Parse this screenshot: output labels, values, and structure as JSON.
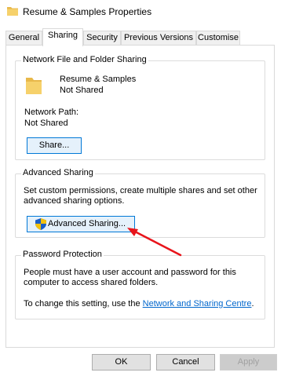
{
  "window": {
    "title": "Resume & Samples Properties"
  },
  "tabs": [
    {
      "label": "General"
    },
    {
      "label": "Sharing"
    },
    {
      "label": "Security"
    },
    {
      "label": "Previous Versions"
    },
    {
      "label": "Customise"
    }
  ],
  "active_tab": "Sharing",
  "network_sharing": {
    "group_title": "Network File and Folder Sharing",
    "folder_name": "Resume & Samples",
    "share_status": "Not Shared",
    "network_path_label": "Network Path:",
    "network_path_value": "Not Shared",
    "share_button": "Share..."
  },
  "advanced_sharing": {
    "group_title": "Advanced Sharing",
    "line1": "Set custom permissions, create multiple shares and set other",
    "line2": "advanced sharing options.",
    "button": "Advanced Sharing..."
  },
  "password_protection": {
    "group_title": "Password Protection",
    "line1": "People must have a user account and password for this",
    "line2": "computer to access shared folders.",
    "change_prefix": "To change this setting, use the ",
    "link_text": "Network and Sharing Centre",
    "change_suffix": "."
  },
  "footer": {
    "ok": "OK",
    "cancel": "Cancel",
    "apply": "Apply"
  },
  "colors": {
    "accent": "#0078d7",
    "link": "#0066cc",
    "annotation_arrow": "#e8141b",
    "folder": "#f6d16b"
  }
}
